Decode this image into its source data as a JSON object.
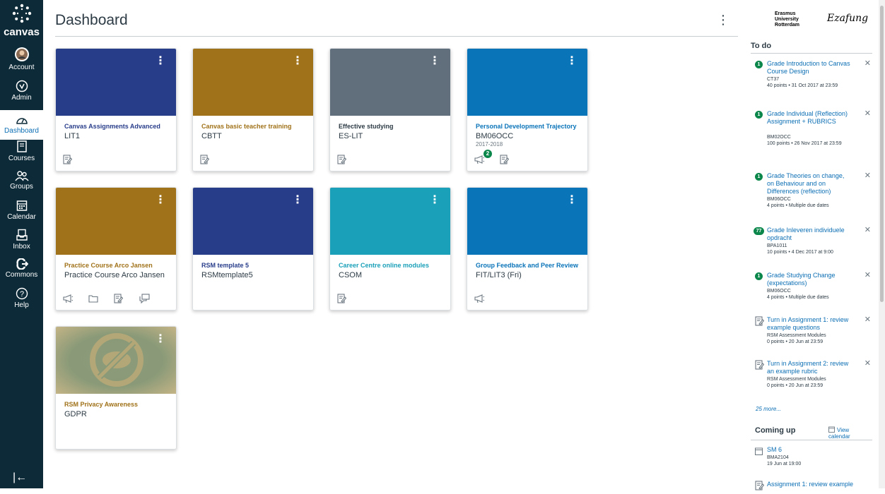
{
  "nav": {
    "logo_text": "canvas",
    "items": [
      {
        "label": "Account"
      },
      {
        "label": "Admin"
      },
      {
        "label": "Dashboard"
      },
      {
        "label": "Courses"
      },
      {
        "label": "Groups"
      },
      {
        "label": "Calendar"
      },
      {
        "label": "Inbox"
      },
      {
        "label": "Commons"
      },
      {
        "label": "Help"
      }
    ],
    "collapse_glyph": "|←"
  },
  "header": {
    "title": "Dashboard",
    "menu_glyph": "⋮"
  },
  "cards": [
    {
      "name": "Canvas Assignments Advanced",
      "code": "LIT1",
      "term": "",
      "color": "#283d8a",
      "name_color": "#283d8a",
      "icons": [
        "assignment-icon"
      ]
    },
    {
      "name": "Canvas basic teacher training",
      "code": "CBTT",
      "term": "",
      "color": "#a07219",
      "name_color": "#a07219",
      "icons": [
        "assignment-icon"
      ]
    },
    {
      "name": "Effective studying",
      "code": "ES-LIT",
      "term": "",
      "color": "#616e7c",
      "name_color": "#2d3b45",
      "icons": [
        "assignment-icon"
      ]
    },
    {
      "name": "Personal Development Trajectory",
      "code": "BM06OCC",
      "term": "2017-2018",
      "color": "#0a74b9",
      "name_color": "#0a74b9",
      "icons": [
        "announcement-icon",
        "assignment-icon"
      ],
      "badge": "2"
    },
    {
      "name": "Practice Course Arco Jansen",
      "code": "Practice Course Arco Jansen",
      "term": "",
      "color": "#a07219",
      "name_color": "#a07219",
      "icons": [
        "announcement-icon",
        "folder-icon",
        "assignment-icon",
        "discussion-icon"
      ]
    },
    {
      "name": "RSM template 5",
      "code": "RSMtemplate5",
      "term": "",
      "color": "#283d8a",
      "name_color": "#283d8a",
      "icons": []
    },
    {
      "name": "Career Centre online modules",
      "code": "CSOM",
      "term": "",
      "color": "#1aa0b8",
      "name_color": "#1aa0b8",
      "icons": [
        "assignment-icon"
      ]
    },
    {
      "name": "Group Feedback and Peer Review",
      "code": "FIT/LIT3 (Fri)",
      "term": "",
      "color": "#0a74b9",
      "name_color": "#0a74b9",
      "icons": [
        "announcement-icon"
      ]
    },
    {
      "name": "RSM Privacy Awareness",
      "code": "GDPR",
      "term": "",
      "color": "#8a9a78",
      "name_color": "#a07219",
      "icons": [],
      "image": true
    }
  ],
  "sidebar": {
    "logo_lines": [
      "Erasmus",
      "University",
      "Rotterdam"
    ],
    "signature": "Ezafung",
    "todo_title": "To do",
    "todos": [
      {
        "badge": "1",
        "title": "Grade Introduction to Canvas Course Design",
        "course": "CT37",
        "meta": "40 points • 31 Oct 2017 at 23:59"
      },
      {
        "badge": "1",
        "title": "Grade Individual (Reflection) Assignment + RUBRICS",
        "course": "BM02OCC",
        "meta": "100 points • 26 Nov 2017 at 23:59"
      },
      {
        "badge": "1",
        "title": "Grade Theories on change, on Behaviour and on Differences (reflection)",
        "course": "BM06OCC",
        "meta": "4 points • Multiple due dates"
      },
      {
        "badge": "77",
        "title": "Grade Inleveren individuele opdracht",
        "course": "BPA1011",
        "meta": "10 points • 4 Dec 2017 at 9:00"
      },
      {
        "badge": "1",
        "title": "Grade Studying Change (expectations)",
        "course": "BM06OCC",
        "meta": "4 points • Multiple due dates"
      },
      {
        "badge": "",
        "title": "Turn in Assignment 1: review example questions",
        "course": "RSM Assessment Modules",
        "meta": "0 points • 20 Jun at 23:59"
      },
      {
        "badge": "",
        "title": "Turn in Assignment 2: review an example rubric",
        "course": "RSM Assessment Modules",
        "meta": "0 points • 20 Jun at 23:59"
      }
    ],
    "more_text": "25 more...",
    "coming_up_title": "Coming up",
    "view_calendar": "View calendar",
    "coming": [
      {
        "title": "SM 6",
        "course": "BMA2104",
        "meta": "19 Jun at 19:00"
      },
      {
        "title": "Assignment 1: review example",
        "course": "",
        "meta": ""
      }
    ]
  }
}
